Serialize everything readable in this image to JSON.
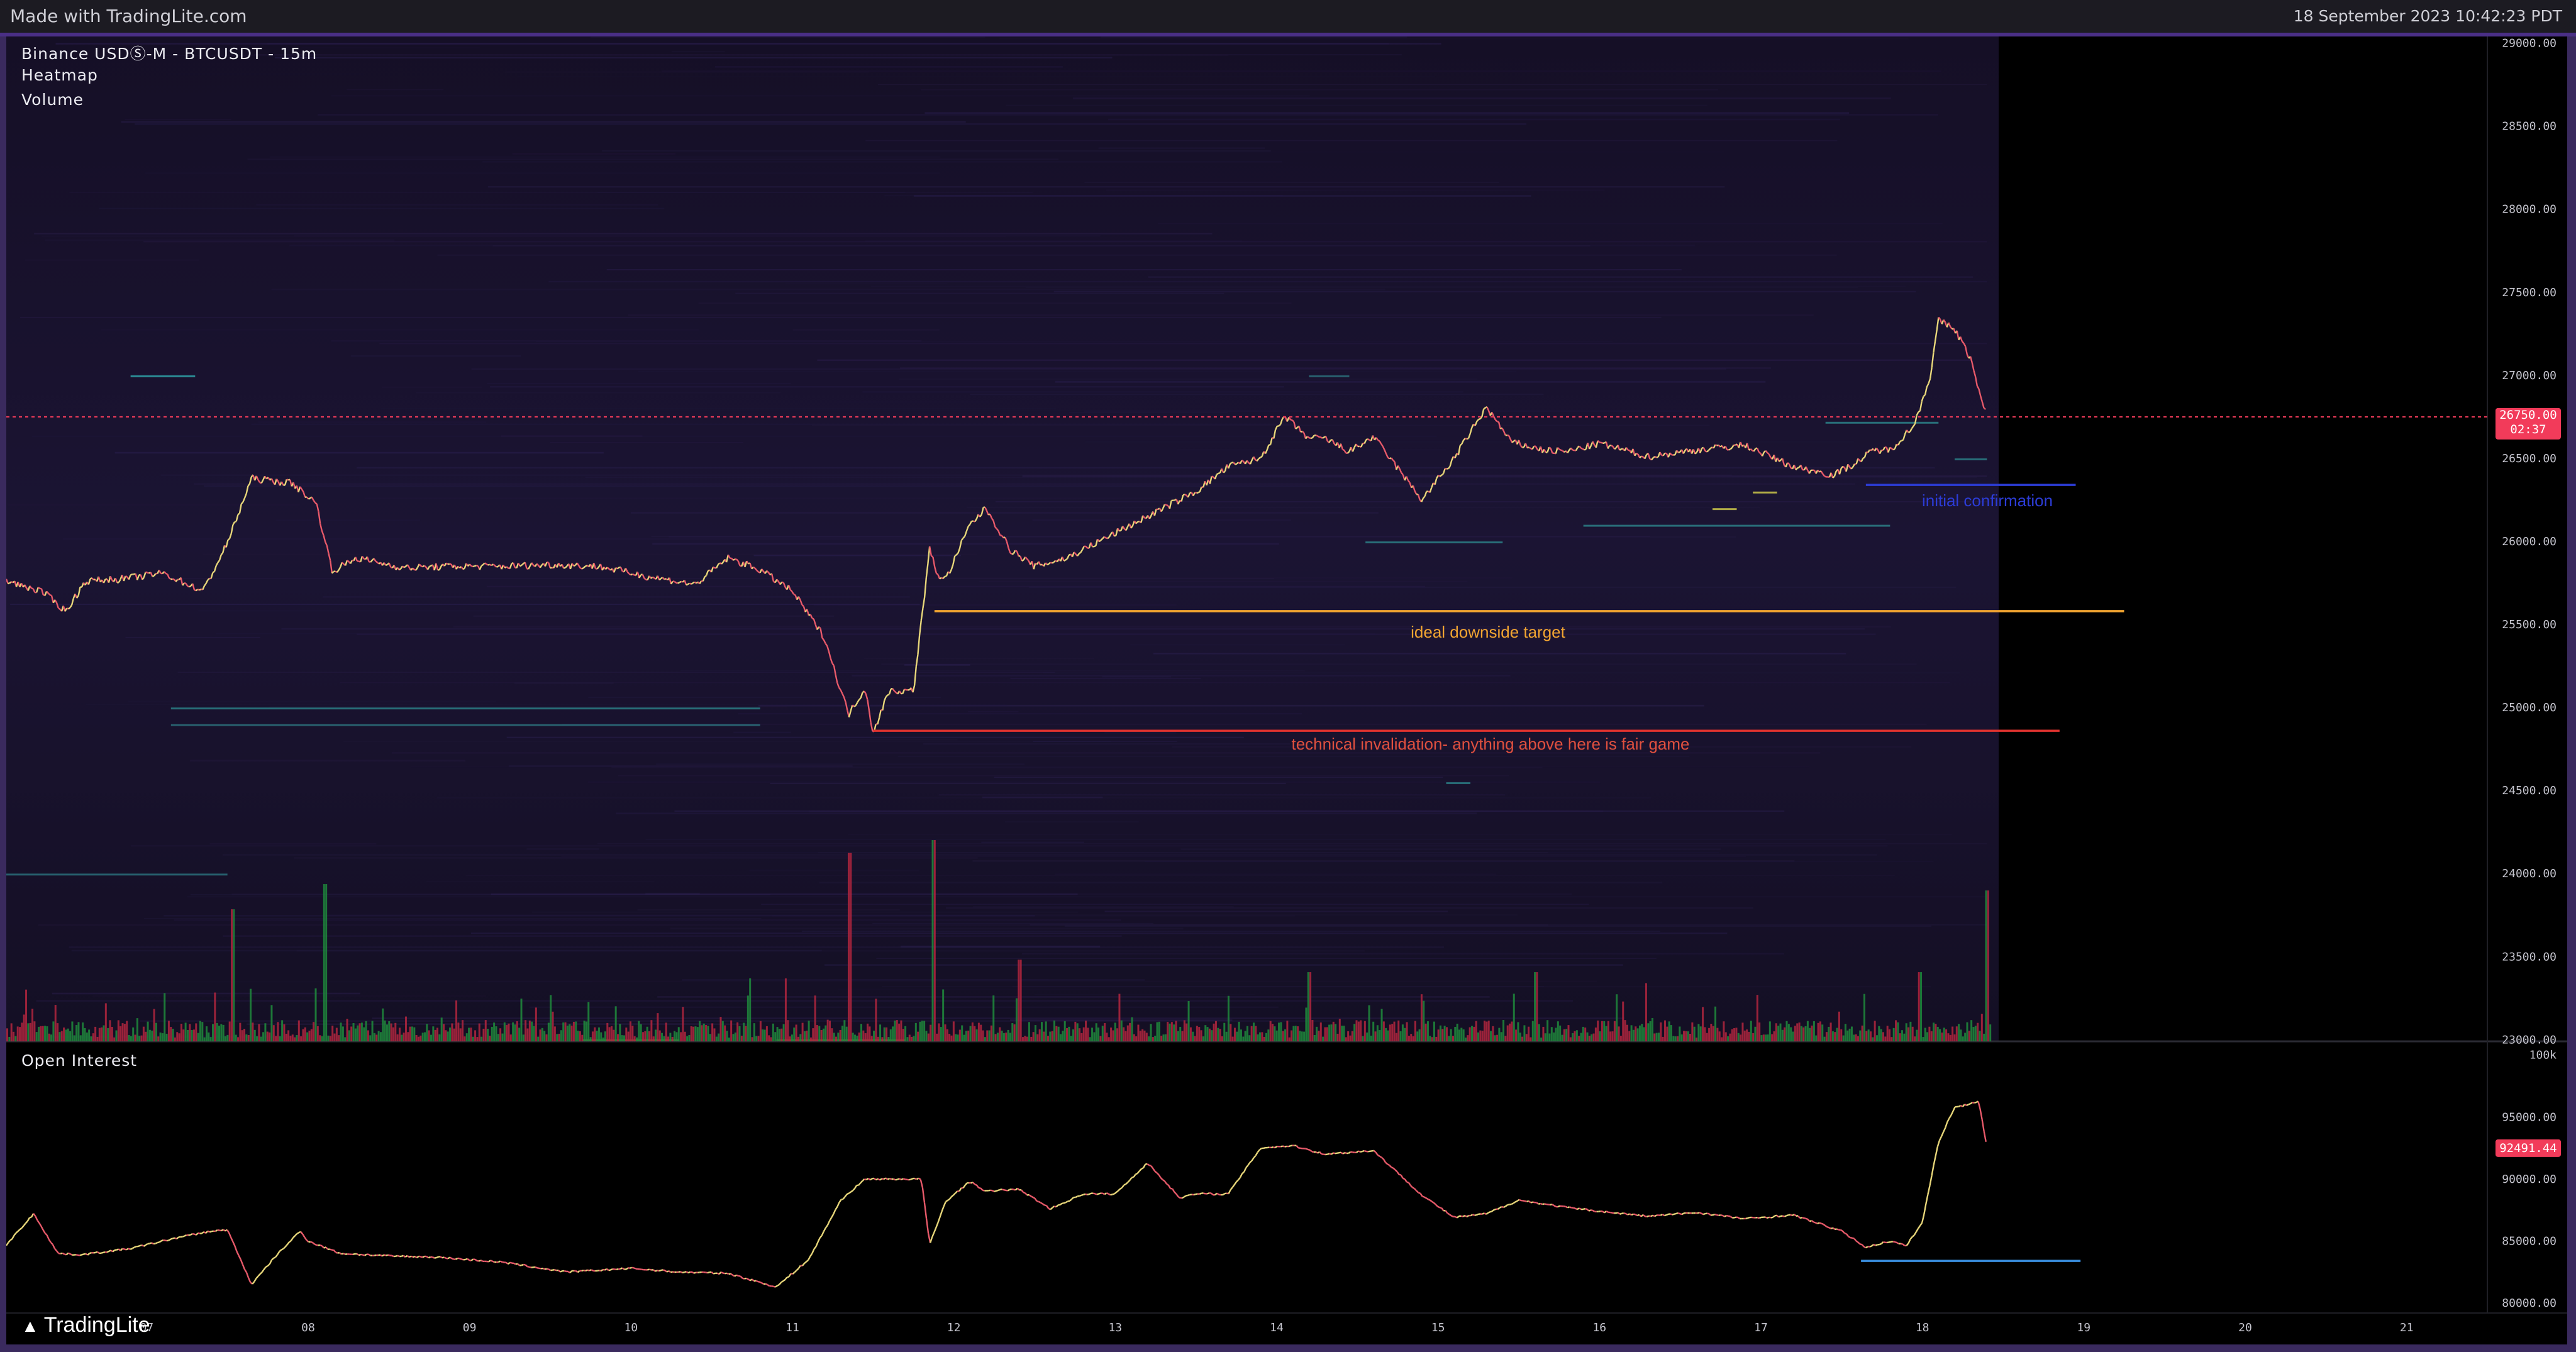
{
  "header": {
    "made_with": "Made with TradingLite.com",
    "timestamp": "18 September 2023 10:42:23 PDT"
  },
  "main_panel": {
    "legend": [
      "Binance USDⓈ-M - BTCUSDT - 15m",
      "Heatmap",
      "Volume"
    ],
    "last_price_label": "26750.00",
    "countdown_label": "02:37"
  },
  "oi_panel": {
    "title": "Open Interest",
    "last_value_label": "92491.44"
  },
  "annotations": {
    "initial_confirmation": "initial confirmation",
    "ideal_downside_target": "ideal downside target",
    "technical_invalidation": "technical invalidation- anything above here is fair game"
  },
  "colors": {
    "price_up": "#e8d77a",
    "price_down": "#e85a6a",
    "heatmap_bg": "#1a1230",
    "target_line": "#f2a531",
    "invalidation_line": "#e0332f",
    "confirmation_line": "#2c3cd6",
    "oi_support_line": "#3a8fe0",
    "last_price_tag": "#f23b5a"
  },
  "logo": {
    "name": "TradingLite",
    "icon": "tradinglite-logo-icon"
  },
  "chart_data": [
    {
      "type": "line",
      "subtype": "candlestick-with-heatmap",
      "x_axis_labels": [
        "07",
        "08",
        "09",
        "10",
        "11",
        "12",
        "13",
        "14",
        "15",
        "16",
        "17",
        "18",
        "19",
        "20",
        "21"
      ],
      "y_axis_labels": [
        "29000.00",
        "28500.00",
        "28000.00",
        "27500.00",
        "27000.00",
        "26500.00",
        "26000.00",
        "25500.00",
        "25000.00",
        "24500.00",
        "24000.00",
        "23500.00",
        "23000.00"
      ],
      "ylim": [
        22990,
        29040
      ],
      "x_range_days": [
        6.13,
        21.5
      ],
      "series": [
        {
          "x": [
            6.13,
            6.35,
            6.5,
            6.62,
            6.9,
            7.1,
            7.35,
            7.5,
            7.65,
            7.9,
            8.05,
            8.15,
            8.3,
            8.6,
            8.9,
            9.2,
            9.5,
            9.8,
            10.1,
            10.4,
            10.6,
            10.8,
            11.0,
            11.2,
            11.3,
            11.35,
            11.45,
            11.5,
            11.6,
            11.75,
            11.85,
            11.9,
            11.95,
            12.1,
            12.2,
            12.35,
            12.5,
            12.7,
            12.9,
            13.1,
            13.3,
            13.5,
            13.7,
            13.9,
            14.05,
            14.2,
            14.3,
            14.45,
            14.6,
            14.9,
            15.1,
            15.3,
            15.45,
            15.65,
            15.8,
            16.0,
            16.3,
            16.6,
            16.9,
            17.2,
            17.45,
            17.6,
            17.7,
            17.8,
            17.95,
            18.05,
            18.1,
            18.2,
            18.3,
            18.35,
            18.4
          ],
          "y": [
            25760,
            25700,
            25580,
            25760,
            25780,
            25810,
            25700,
            25990,
            26380,
            26350,
            26230,
            25820,
            25900,
            25840,
            25850,
            25850,
            25860,
            25850,
            25790,
            25740,
            25900,
            25830,
            25700,
            25420,
            25100,
            24960,
            25120,
            24850,
            25100,
            25100,
            25950,
            25800,
            25770,
            26100,
            26200,
            25950,
            25850,
            25900,
            26000,
            26100,
            26200,
            26300,
            26450,
            26500,
            26750,
            26620,
            26620,
            26540,
            26630,
            26250,
            26500,
            26810,
            26600,
            26550,
            26540,
            26590,
            26510,
            26550,
            26580,
            26450,
            26400,
            26480,
            26550,
            26550,
            26700,
            27000,
            27330,
            27280,
            27100,
            26900,
            26750
          ]
        }
      ],
      "horizontal_levels": [
        {
          "label": "initial confirmation",
          "price": 26340
        },
        {
          "label": "ideal downside target",
          "price": 25580
        },
        {
          "label": "technical invalidation- anything above here is fair game",
          "price": 24860
        }
      ]
    },
    {
      "type": "line",
      "title": "Open Interest",
      "y_axis_labels": [
        "100k",
        "95000.00",
        "90000.00",
        "85000.00",
        "80000.00"
      ],
      "ylim": [
        79200,
        101100
      ],
      "series": [
        {
          "x": [
            6.13,
            6.3,
            6.45,
            6.6,
            6.9,
            7.2,
            7.4,
            7.5,
            7.65,
            7.8,
            7.95,
            8.0,
            8.2,
            8.5,
            8.8,
            9.2,
            9.6,
            10.0,
            10.3,
            10.6,
            10.9,
            11.1,
            11.3,
            11.45,
            11.6,
            11.8,
            11.85,
            11.95,
            12.1,
            12.2,
            12.4,
            12.6,
            12.8,
            13.0,
            13.2,
            13.4,
            13.5,
            13.7,
            13.9,
            14.1,
            14.3,
            14.4,
            14.6,
            14.9,
            15.1,
            15.3,
            15.5,
            15.8,
            16.0,
            16.3,
            16.6,
            16.9,
            17.2,
            17.5,
            17.65,
            17.8,
            17.9,
            18.0,
            18.1,
            18.2,
            18.25,
            18.35,
            18.4
          ],
          "y": [
            84700,
            87200,
            84000,
            83900,
            84400,
            85300,
            85800,
            85900,
            81500,
            83800,
            85800,
            85000,
            84000,
            83800,
            83700,
            83300,
            82500,
            82800,
            82500,
            82400,
            81300,
            83500,
            88300,
            90000,
            90000,
            90000,
            84700,
            88200,
            89800,
            89000,
            89200,
            87600,
            88800,
            88800,
            91300,
            88500,
            88800,
            88800,
            92500,
            92700,
            92000,
            92100,
            92300,
            88700,
            86900,
            87200,
            88300,
            87700,
            87400,
            87000,
            87300,
            86800,
            87100,
            85800,
            84500,
            85000,
            84600,
            86500,
            93000,
            95800,
            95900,
            96300,
            92491
          ]
        }
      ],
      "horizontal_levels": [
        {
          "price": 83400
        }
      ]
    }
  ]
}
